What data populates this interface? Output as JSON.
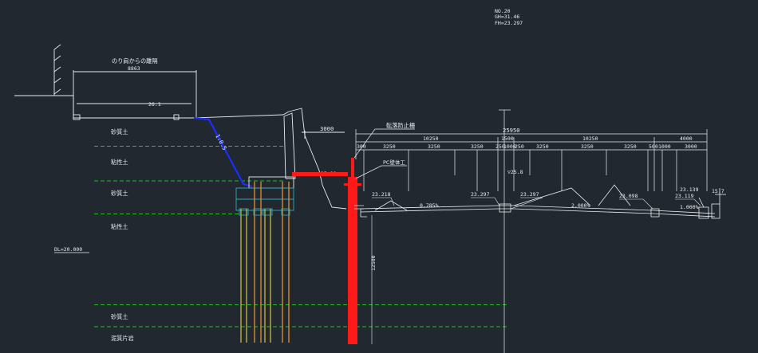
{
  "header": {
    "no": "NO.20",
    "gh": "GH=31.46",
    "fh": "FH=23.297"
  },
  "labels": {
    "slope_width_title": "のり肩からの離隔",
    "slope_width_value": "8863",
    "slope_width_2": "26.1",
    "slope_ratio": "1:0.5",
    "guardrail": "転落防止柵",
    "pc_wall": "PC壁体工",
    "dl": "DL=20.000",
    "pile_length": "12500",
    "dim_3000": "3000",
    "elev_2580": "▽25.80",
    "elev_258": "▽25.8"
  },
  "soil_layers": [
    "砂質土",
    "粘性土",
    "砂質土",
    "粘性土",
    "砂質土",
    "泥質片岩"
  ],
  "top_dims": {
    "total": "25950",
    "left_span": "10250",
    "mid": "1500",
    "right_span": "10250",
    "end": "4000",
    "row": [
      "300",
      "3250",
      "3250",
      "3250",
      "250",
      "1000",
      "250",
      "3250",
      "3250",
      "3250",
      "500",
      "1000",
      "3000"
    ]
  },
  "elevations": [
    "23.218",
    "23.297",
    "23.297",
    "23.098",
    "23.139",
    "23.119",
    "15.7"
  ],
  "slopes": [
    "0.785%",
    "2.000%",
    "1.000%"
  ],
  "colors": {
    "background": "#212830",
    "line": "#e9edf1",
    "soil": "#2fb52f",
    "wall": "#ff1a1a",
    "slope": "#1a2eff"
  }
}
